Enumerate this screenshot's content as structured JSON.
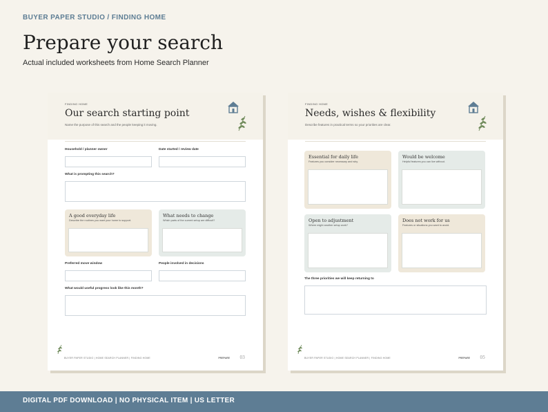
{
  "header": {
    "brand": "BUYER PAPER STUDIO  /  FINDING HOME",
    "title": "Prepare your search",
    "subtitle": "Actual included worksheets from Home Search Planner"
  },
  "page1": {
    "eyebrow": "FINDING HOME",
    "title": "Our search starting point",
    "description": "Name the purpose of this search and the people keeping it moving.",
    "labels": {
      "owner": "Household / planner owner",
      "date": "Date started / review date",
      "prompting": "What is prompting this search?",
      "move_window": "Preferred move window",
      "people": "People involved in decisions",
      "progress": "What would useful progress look like this month?"
    },
    "cards": [
      {
        "title": "A good everyday life",
        "desc": "Describe the routines you want your home to support."
      },
      {
        "title": "What needs to change",
        "desc": "Which parts of the current setup are difficult?"
      }
    ],
    "footer": "BUYER PAPER STUDIO  |  HOME SEARCH PLANNER  |  FINDING HOME",
    "section": "PREPARE",
    "number": "03"
  },
  "page2": {
    "eyebrow": "FINDING HOME",
    "title": "Needs, wishes & flexibility",
    "description": "Describe features in practical terms so your priorities are clear.",
    "cards": [
      {
        "title": "Essential for daily life",
        "desc": "Features you consider necessary and why."
      },
      {
        "title": "Would be welcome",
        "desc": "Helpful features you can live without."
      },
      {
        "title": "Open to adjustment",
        "desc": "Where might another setup work?"
      },
      {
        "title": "Does not work for us",
        "desc": "Features or situations you want to avoid."
      }
    ],
    "priorities_label": "The three priorities we will keep returning to",
    "footer": "BUYER PAPER STUDIO  |  HOME SEARCH PLANNER  |  FINDING HOME",
    "section": "PREPARE",
    "number": "05"
  },
  "bottom_bar": {
    "text": "DIGITAL PDF DOWNLOAD  |  NO PHYSICAL ITEM  |  US LETTER"
  },
  "colors": {
    "background": "#f6f3ec",
    "accent": "#5e7d94",
    "card_beige": "#efe8da",
    "card_grey": "#e5ebe8",
    "leaf": "#6f8a5a"
  },
  "icons": [
    "house-icon",
    "leaf-icon",
    "sprig-icon"
  ]
}
